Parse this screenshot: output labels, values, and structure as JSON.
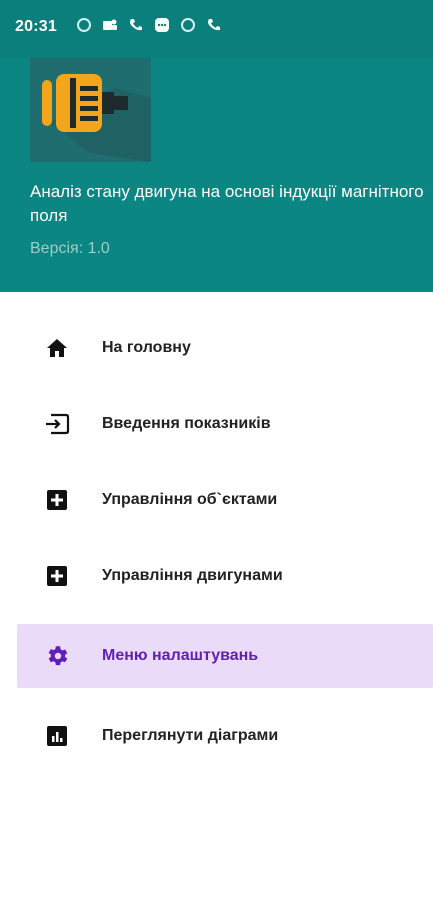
{
  "status_bar": {
    "time": "20:31",
    "icons": [
      "circle-icon",
      "teams-icon",
      "phone-icon",
      "chat-icon",
      "circle-icon",
      "phone-icon"
    ]
  },
  "header": {
    "title": "Аналіз стану двигуна на основі індукції магнітного поля",
    "version_label": "Версія: 1.0",
    "logo_icon": "motor-icon"
  },
  "menu": {
    "items": [
      {
        "label": "На головну",
        "icon": "home-icon",
        "active": false
      },
      {
        "label": "Введення показників",
        "icon": "input-icon",
        "active": false
      },
      {
        "label": "Управління об`єктами",
        "icon": "add-box-icon",
        "active": false
      },
      {
        "label": "Управління двигунами",
        "icon": "add-box-icon",
        "active": false
      },
      {
        "label": "Меню налаштувань",
        "icon": "gear-icon",
        "active": true
      },
      {
        "label": "Переглянути діаграми",
        "icon": "chart-icon",
        "active": false
      }
    ]
  },
  "colors": {
    "header_bg": "#0b8682",
    "status_bg": "#0b7f7c",
    "active_bg": "#eadcf8",
    "active_text": "#5f1fb8"
  }
}
